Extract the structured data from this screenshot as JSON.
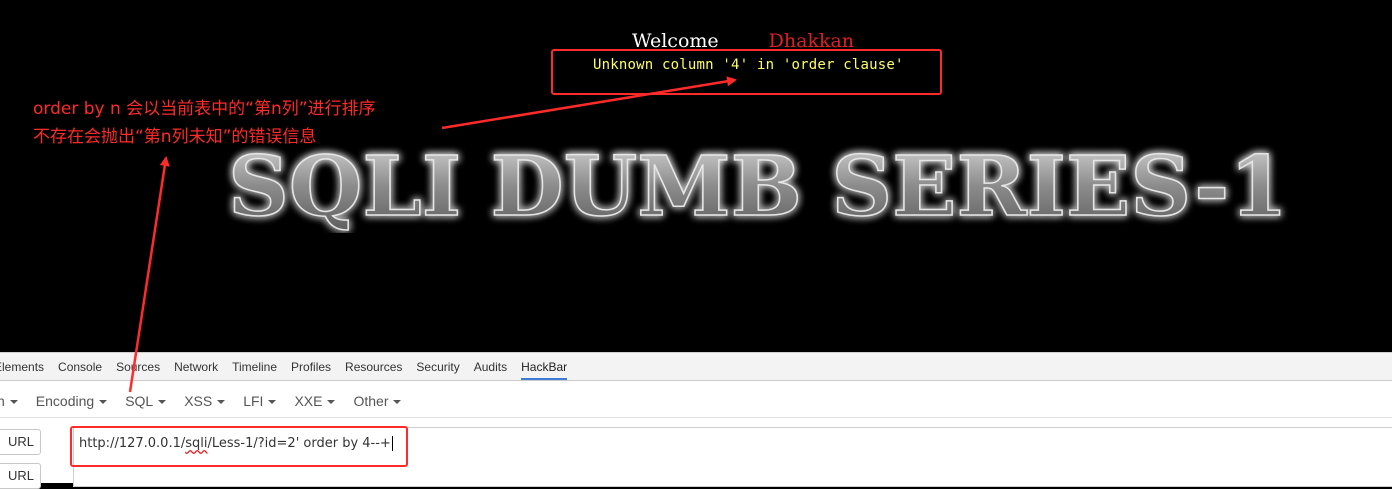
{
  "page": {
    "welcome_label": "Welcome",
    "welcome_name": "Dhakkan",
    "sql_error": "Unknown column '4' in 'order clause'",
    "banner": "SQLI DUMB SERIES-1"
  },
  "annotation": {
    "line1": "order by n 会以当前表中的“第n列”进行排序",
    "line2": "不存在会抛出“第n列未知”的错误信息"
  },
  "devtools": {
    "tabs": [
      "Elements",
      "Console",
      "Sources",
      "Network",
      "Timeline",
      "Profiles",
      "Resources",
      "Security",
      "Audits",
      "HackBar"
    ],
    "active_tab": "HackBar"
  },
  "hackbar": {
    "menus": [
      "n",
      "Encoding",
      "SQL",
      "XSS",
      "LFI",
      "XXE",
      "Other"
    ],
    "load_button": "URL",
    "split_button": "URL",
    "url_host": "http://127.0.0.1/",
    "url_sqli": "sqli",
    "url_rest": "/Less-1/?id=2' order by 4--+"
  },
  "colors": {
    "annotation_red": "#ff2a2a",
    "error_yellow": "#ffff66",
    "name_red": "#e02020",
    "active_tab_underline": "#3e7ad8"
  }
}
